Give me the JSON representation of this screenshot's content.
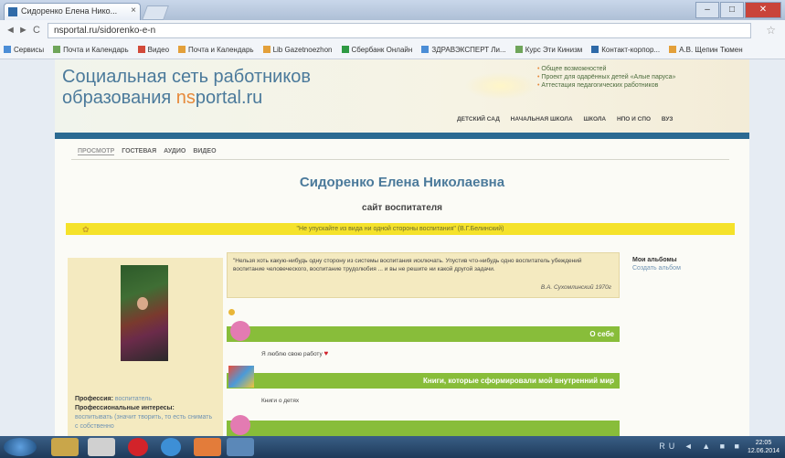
{
  "browser": {
    "tab_title": "Сидоренко Елена Нико...",
    "tab_close": "×",
    "url": "nsportal.ru/sidorenko-e-n",
    "back": "◄",
    "forward": "►",
    "reload": "C",
    "bookmark_star": "☆",
    "window_min": "–",
    "window_max": "□",
    "window_close": "✕",
    "bookmarks": [
      {
        "label": "Сервисы",
        "color": "#4b8dd6"
      },
      {
        "label": "Почта и Календарь",
        "color": "#6fa55a"
      },
      {
        "label": "Видео",
        "color": "#d24a3a"
      },
      {
        "label": "Почта и Календарь",
        "color": "#e3a03a"
      },
      {
        "label": "Lib Gazetnoezhon",
        "color": "#e3a03a"
      },
      {
        "label": "Сбербанк Онлайн",
        "color": "#2f9a43"
      },
      {
        "label": "ЗДРАВЭКСПЕРТ Ли...",
        "color": "#4b8dd6"
      },
      {
        "label": "Курс Эти Кинизм",
        "color": "#6fa55a"
      },
      {
        "label": "Контакт-корпор...",
        "color": "#2f6aa8"
      },
      {
        "label": "А.В. Щепин Тюмен",
        "color": "#e3a03a"
      }
    ]
  },
  "site": {
    "title_line1": "Социальная сеть работников",
    "title_line2_prefix": "образования ",
    "title_line2_ns": "ns",
    "title_line2_suffix": "portal.ru",
    "header_links": [
      "Общее возможностей",
      "Проект для одарённых детей «Алые паруса»",
      "Аттестация педагогических работников"
    ],
    "top_nav": [
      "ДЕТСКИЙ САД",
      "НАЧАЛЬНАЯ ШКОЛА",
      "ШКОЛА",
      "НПО И СПО",
      "ВУЗ"
    ]
  },
  "profile": {
    "subtabs": [
      "ПРОСМОТР",
      "ГОСТЕВАЯ",
      "АУДИО",
      "ВИДЕО"
    ],
    "name": "Сидоренко Елена Николаевна",
    "role": "сайт воспитателя",
    "motto": "\"Не упускайте из вида ни одной стороны воспитания\" (В.Г.Белинский)",
    "profession_label": "Профессия:",
    "profession_value": "воспитатель",
    "interests_label": "Профессиональные интересы:",
    "interests_value": "воспитывать (значит творить, то есть снимать с собственно",
    "quote_text": "\"Нельзя хоть какую-нибудь одну сторону из системы воспитания исключать. Упустив что-нибудь одно воспитатель убеждений воспитание человеческого, воспитание трудолюбия ... и вы не решите ни какой другой задачи.",
    "quote_author": "В.А. Сухомлинский 1970г",
    "section_about": "О себе",
    "about_text": "Я люблю свою работу",
    "section_books": "Книги, которые сформировали мой внутренний мир",
    "books_text": "Книги о детях",
    "albums_label": "Мои альбомы",
    "create_album": "Создать альбом"
  },
  "taskbar": {
    "clock_time": "22:05",
    "clock_date": "12.06.2014",
    "tray": "RU ◄ ▲ ■ ■"
  },
  "colors": {
    "green_bar": "#88bd3a",
    "yellow_bar": "#f5e22a",
    "blue_bar": "#2b6a92",
    "site_blue": "#4b7a9b",
    "site_orange": "#e6893a"
  }
}
